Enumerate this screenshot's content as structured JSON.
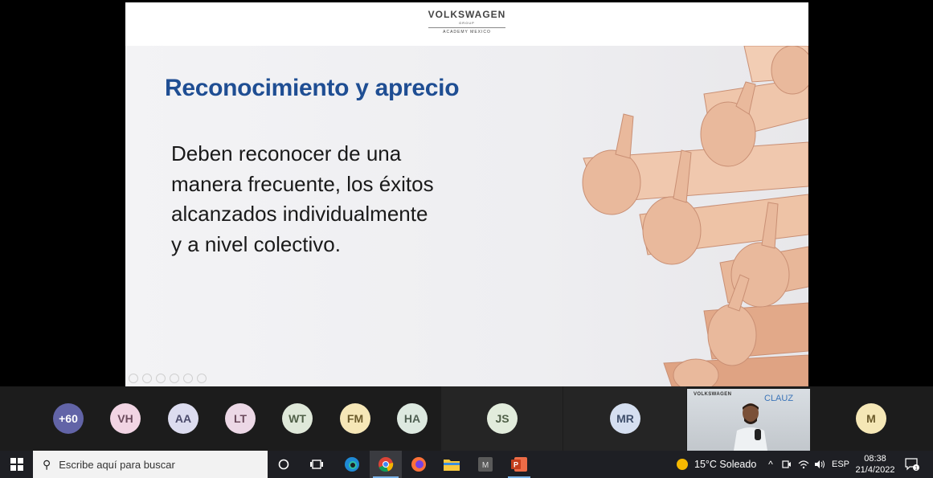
{
  "slide": {
    "logo_name": "VOLKSWAGEN",
    "logo_group": "GROUP",
    "logo_academy": "ACADEMY MEXICO",
    "title": "Reconocimiento y aprecio",
    "lines": [
      "Deben reconocer de una",
      "manera frecuente, los éxitos",
      "alcanzados individualmente",
      "y a nivel colectivo."
    ],
    "title_color": "#1f4e93"
  },
  "participants": [
    {
      "initials": "+60",
      "color": "#6264a7",
      "text_color": "#ffffff"
    },
    {
      "initials": "VH",
      "color": "#f1d4e3",
      "text_color": "#6b4a5c"
    },
    {
      "initials": "AA",
      "color": "#dcdcef",
      "text_color": "#4b4b6b"
    },
    {
      "initials": "LT",
      "color": "#ecd8e6",
      "text_color": "#6b4a5c"
    },
    {
      "initials": "WT",
      "color": "#dfe8d9",
      "text_color": "#4f5f47"
    },
    {
      "initials": "FM",
      "color": "#f6e7b7",
      "text_color": "#6b5a2a"
    },
    {
      "initials": "HA",
      "color": "#dde9e0",
      "text_color": "#4f5f52"
    },
    {
      "initials": "JS",
      "color": "#e2ecdc",
      "text_color": "#4f5f47"
    },
    {
      "initials": "MR",
      "color": "#d5dff0",
      "text_color": "#3f4f6b"
    },
    {
      "initials": "M",
      "color": "#f5e7b6",
      "text_color": "#6b5a2a"
    }
  ],
  "video": {
    "logo": "VOLKSWAGEN",
    "brand": "CLAUZ"
  },
  "taskbar": {
    "search_placeholder": "Escribe aquí para buscar",
    "weather": "15°C  Soleado",
    "language": "ESP",
    "time": "08:38",
    "date": "21/4/2022",
    "notification_count": "1"
  }
}
